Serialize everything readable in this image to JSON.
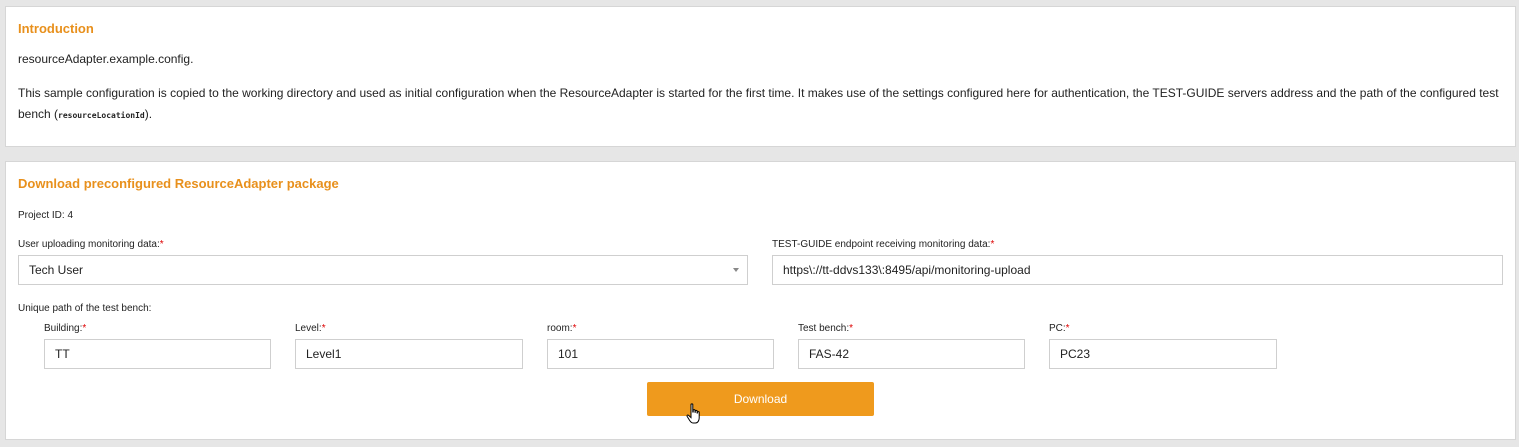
{
  "intro": {
    "title": "Introduction",
    "filename": "resourceAdapter.example.config.",
    "desc_main": "This sample configuration is copied to the working directory and used as initial configuration when the ResourceAdapter is started for the first time. It makes use of the settings configured here for authentication, the TEST-GUIDE servers address and the path of the configured test bench (",
    "desc_code": "resourceLocationId",
    "desc_end": ")."
  },
  "download": {
    "title": "Download preconfigured ResourceAdapter package",
    "project_id": "Project ID: 4",
    "user_label": "User uploading monitoring data:",
    "user_value": "Tech User",
    "endpoint_label": "TEST-GUIDE endpoint receiving monitoring data:",
    "endpoint_value": "https\\://tt-ddvs133\\:8495/api/monitoring-upload",
    "path_label": "Unique path of the test bench:",
    "required_mark": "*",
    "fields": [
      {
        "label": "Building:",
        "value": "TT"
      },
      {
        "label": "Level:",
        "value": "Level1"
      },
      {
        "label": "room:",
        "value": "101"
      },
      {
        "label": "Test bench:",
        "value": "FAS-42"
      },
      {
        "label": "PC:",
        "value": "PC23"
      }
    ],
    "button_label": "Download"
  },
  "colors": {
    "accent": "#e8901c",
    "button": "#ef9a1d",
    "required": "#dd0000"
  },
  "icons": {
    "cursor": "hand-pointer-icon",
    "dropdown": "caret-down-icon"
  }
}
